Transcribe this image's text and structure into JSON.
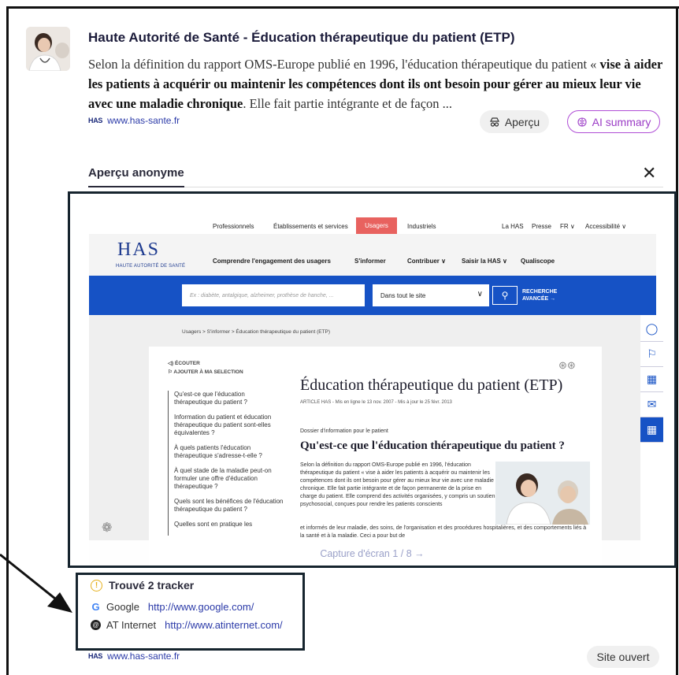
{
  "result": {
    "title": "Haute Autorité de Santé - Éducation thérapeutique du patient (ETP)",
    "snippet_pre": "Selon la définition du rapport OMS-Europe publié en 1996, l'éducation thérapeutique du patient « ",
    "snippet_bold1": "vise à aider les patients à acquérir ou maintenir les compétences dont ils ont besoin pour gérer au mieux leur vie avec une maladie chronique",
    "snippet_post": ". Elle fait partie intégrante et de façon ...",
    "site_logo": "HAS",
    "site_url": "www.has-sante.fr",
    "apercu_label": "Aperçu",
    "ai_summary_label": "AI summary"
  },
  "preview": {
    "heading": "Aperçu anonyme",
    "close_label": "✕",
    "caption": "Capture d'écran  1 / 8   →"
  },
  "shot": {
    "topnav": [
      "Professionnels",
      "Établissements et services",
      "Usagers",
      "Industriels",
      "La HAS",
      "Presse",
      "FR ∨",
      "Accessibilité ∨"
    ],
    "logo": "HAS",
    "logo_sub": "HAUTE AUTORITÉ DE SANTÉ",
    "mainnav": [
      "Comprendre l'engagement des usagers",
      "S'informer",
      "Contribuer ∨",
      "Saisir la HAS ∨",
      "Qualiscope"
    ],
    "search_placeholder": "Ex : diabète, antalgique, alzheimer, prothèse de hanche, ...",
    "search_scope": "Dans tout le site",
    "advanced_search_line1": "RECHERCHE",
    "advanced_search_line2": "AVANCÉE  →",
    "breadcrumb": "Usagers  >  S'informer  >  Éducation thérapeutique du patient (ETP)",
    "ecouter": "ÉCOUTER",
    "ajouter": "AJOUTER À MA SELECTION",
    "toc": [
      "Qu'est-ce que l'éducation thérapeutique du patient ?",
      "Information du patient et éducation thérapeutique du patient sont-elles équivalentes ?",
      "À quels patients l'éducation thérapeutique s'adresse-t-elle ?",
      "À quel stade de la maladie peut-on formuler une offre d'éducation thérapeutique ?",
      "Quels sont les bénéfices de l'éducation thérapeutique du patient ?",
      "Quelles sont en pratique les"
    ],
    "article_title": "Éducation thérapeutique du patient (ETP)",
    "article_meta": "ARTICLE HAS - Mis en ligne le 13 nov. 2007 - Mis à jour le 25 févr. 2013",
    "dossier": "Dossier d'information pour le patient",
    "h2": "Qu'est-ce que l'éducation thérapeutique du patient ?",
    "body": "Selon la définition du rapport OMS-Europe publié en 1996, l'éducation thérapeutique du patient « vise à aider les patients à acquérir ou maintenir les compétences dont ils ont besoin pour gérer au mieux leur vie avec une maladie chronique. Elle fait partie intégrante et de façon permanente de la prise en charge du patient. Elle comprend des activités organisées, y compris un soutien psychosocial, conçues pour rendre les patients conscients",
    "body_wide": "et informés de leur maladie, des soins, de l'organisation et des procédures hospitalières, et des comportements liés à la santé et à la maladie. Ceci a pour but de"
  },
  "trackers": {
    "title": "Trouvé 2 tracker",
    "items": [
      {
        "icon": "G",
        "name": "Google",
        "url": "http://www.google.com/"
      },
      {
        "icon": "@",
        "name": "AT Internet",
        "url": "http://www.atinternet.com/"
      }
    ]
  },
  "footer": {
    "site_logo": "HAS",
    "site_url": "www.has-sante.fr",
    "open_label": "Site ouvert"
  },
  "colors": {
    "accent_purple": "#9b3cc6",
    "link_blue": "#2b3aa8",
    "has_blue": "#1652c5",
    "usagers_red": "#e8625f"
  }
}
